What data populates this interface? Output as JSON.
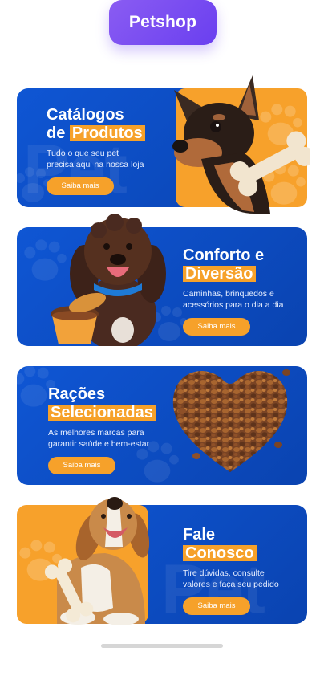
{
  "brand": {
    "name": "Petshop"
  },
  "cards": [
    {
      "title_line1": "Catálogos",
      "title_line2_prefix": "de ",
      "title_highlight": "Produtos",
      "description_line1": "Tudo o que seu pet",
      "description_line2": "precisa aqui na nossa loja",
      "button_label": "Saiba mais",
      "watermark": "Pet",
      "image_icon": "dog-with-bone-icon"
    },
    {
      "title_line1": "Conforto e",
      "title_highlight": "Diversão",
      "description_line1": "Caminhas, brinquedos e",
      "description_line2": "acessórios para o dia a dia",
      "button_label": "Saiba mais",
      "image_icon": "curly-dog-with-food-bowl-icon"
    },
    {
      "title_line1": "Rações",
      "title_highlight": "Selecionadas",
      "description_line1": "As melhores marcas para",
      "description_line2": "garantir saúde e bem-estar",
      "button_label": "Saiba mais",
      "image_icon": "kibble-heart-icon"
    },
    {
      "title_line1": "Fale",
      "title_highlight": "Conosco",
      "description_line1": "Tire dúvidas, consulte",
      "description_line2": "valores e faça seu pedido",
      "button_label": "Saiba mais",
      "watermark": "Pet",
      "image_icon": "beagle-with-bone-icon"
    }
  ],
  "colors": {
    "brand_purple": "#7a4ff1",
    "card_blue": "#0f56d4",
    "accent_orange": "#f6a12a"
  }
}
